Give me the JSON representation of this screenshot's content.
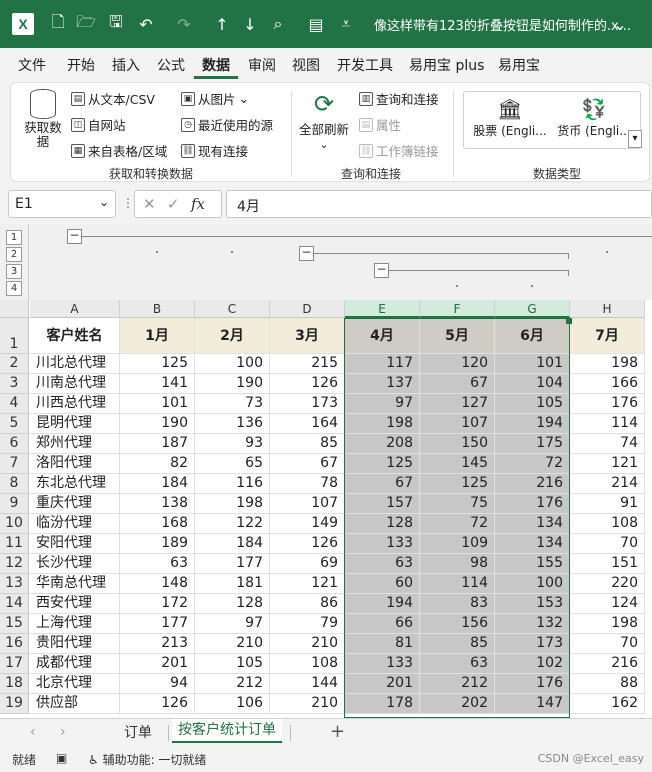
{
  "window": {
    "title": "像这样带有123的折叠按钮是如何制作的.x..."
  },
  "menu": [
    "文件",
    "开始",
    "插入",
    "公式",
    "数据",
    "审阅",
    "视图",
    "开发工具",
    "易用宝 plus",
    "易用宝"
  ],
  "ribbon": {
    "get_data": "获取数\n据",
    "get_data_line1": "获取数",
    "get_data_line2": "据",
    "from_text": "从文本/CSV",
    "from_web": "自网站",
    "from_table": "来自表格/区域",
    "from_picture": "从图片",
    "recent_sources": "最近使用的源",
    "existing_conn": "现有连接",
    "group1": "获取和转换数据",
    "refresh_all": "全部刷新",
    "queries_conn": "查询和连接",
    "properties": "属性",
    "workbook_links": "工作簿链接",
    "group2": "查询和连接",
    "stocks": "股票 (Engli...",
    "currency": "货币 (Engli...",
    "group3": "数据类型"
  },
  "formula_bar": {
    "name_box": "E1",
    "fx": "fx",
    "value": "4月"
  },
  "outline_levels": [
    "1",
    "2",
    "3",
    "4"
  ],
  "columns": [
    "A",
    "B",
    "C",
    "D",
    "E",
    "F",
    "G",
    "H"
  ],
  "headers": [
    "客户姓名",
    "1月",
    "2月",
    "3月",
    "4月",
    "5月",
    "6月",
    "7月"
  ],
  "rows": [
    [
      "川北总代理",
      "125",
      "100",
      "215",
      "117",
      "120",
      "101",
      "198"
    ],
    [
      "川南总代理",
      "141",
      "190",
      "126",
      "137",
      "67",
      "104",
      "166"
    ],
    [
      "川西总代理",
      "101",
      "73",
      "173",
      "97",
      "127",
      "105",
      "176"
    ],
    [
      "昆明代理",
      "190",
      "136",
      "164",
      "198",
      "107",
      "194",
      "114"
    ],
    [
      "郑州代理",
      "187",
      "93",
      "85",
      "208",
      "150",
      "175",
      "74"
    ],
    [
      "洛阳代理",
      "82",
      "65",
      "67",
      "125",
      "145",
      "72",
      "121"
    ],
    [
      "东北总代理",
      "184",
      "116",
      "78",
      "67",
      "125",
      "216",
      "214"
    ],
    [
      "重庆代理",
      "138",
      "198",
      "107",
      "157",
      "75",
      "176",
      "91"
    ],
    [
      "临汾代理",
      "168",
      "122",
      "149",
      "128",
      "72",
      "134",
      "108"
    ],
    [
      "安阳代理",
      "189",
      "184",
      "126",
      "133",
      "109",
      "134",
      "70"
    ],
    [
      "长沙代理",
      "63",
      "177",
      "69",
      "63",
      "98",
      "155",
      "151"
    ],
    [
      "华南总代理",
      "148",
      "181",
      "121",
      "60",
      "114",
      "100",
      "220"
    ],
    [
      "西安代理",
      "172",
      "128",
      "86",
      "194",
      "83",
      "153",
      "124"
    ],
    [
      "上海代理",
      "177",
      "97",
      "79",
      "66",
      "156",
      "132",
      "198"
    ],
    [
      "贵阳代理",
      "213",
      "210",
      "210",
      "81",
      "85",
      "173",
      "70"
    ],
    [
      "成都代理",
      "201",
      "105",
      "108",
      "133",
      "63",
      "102",
      "216"
    ],
    [
      "北京代理",
      "94",
      "212",
      "144",
      "201",
      "212",
      "176",
      "88"
    ],
    [
      "供应部",
      "126",
      "106",
      "210",
      "178",
      "202",
      "147",
      "162"
    ]
  ],
  "row_numbers": [
    "1",
    "2",
    "3",
    "4",
    "5",
    "6",
    "7",
    "8",
    "9",
    "10",
    "11",
    "12",
    "13",
    "14",
    "15",
    "16",
    "17",
    "18",
    "19"
  ],
  "sheets": [
    "订单",
    "按客户统计订单"
  ],
  "status": {
    "ready": "就绪",
    "accessibility": "辅助功能: 一切就绪",
    "watermark": "CSDN @Excel_easy"
  }
}
